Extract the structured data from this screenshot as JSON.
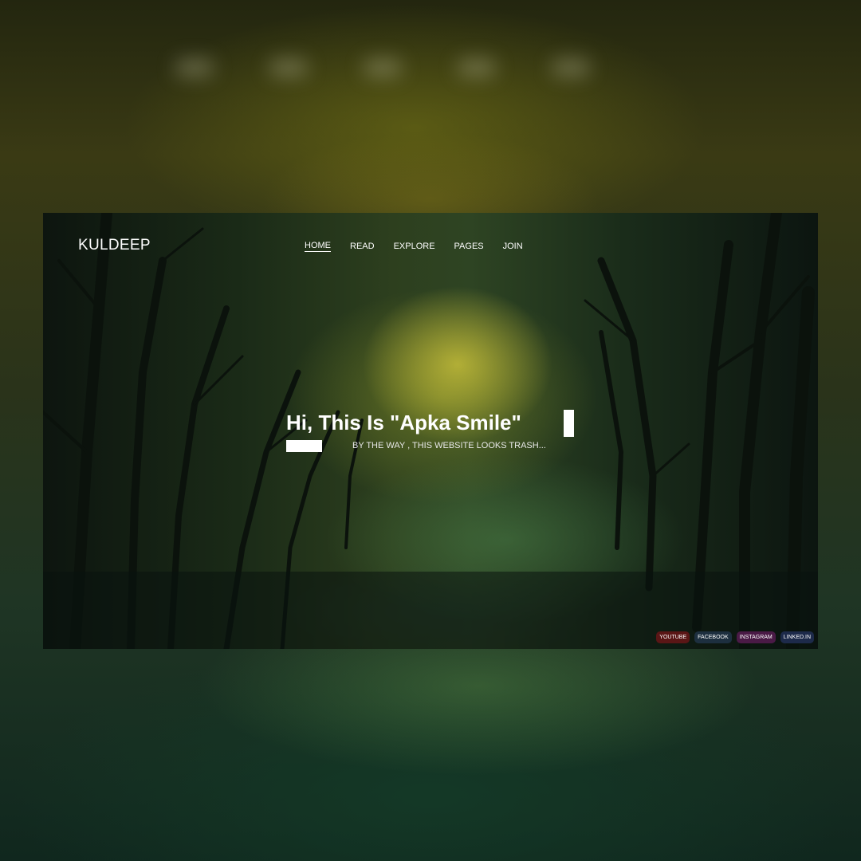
{
  "site": {
    "logo": "KULDEEP",
    "nav": [
      {
        "label": "HOME",
        "active": true
      },
      {
        "label": "READ",
        "active": false
      },
      {
        "label": "EXPLORE",
        "active": false
      },
      {
        "label": "PAGES",
        "active": false
      },
      {
        "label": "JOIN",
        "active": false
      }
    ],
    "hero": {
      "title": "Hi, This Is \"Apka Smile\"",
      "subtitle": "BY THE WAY , THIS WEBSITE LOOKS TRASH..."
    },
    "socials": [
      {
        "label": "YOUTUBE",
        "color": "#5a1616"
      },
      {
        "label": "FACEBOOK",
        "color": "#1d2f3f"
      },
      {
        "label": "INSTAGRAM",
        "color": "#4a1a46"
      },
      {
        "label": "LINKED.IN",
        "color": "#1d2a4a"
      }
    ]
  },
  "colors": {
    "text": "#ffffff",
    "forest_glow": "#c8c23c",
    "forest_dark": "#0d150f"
  }
}
